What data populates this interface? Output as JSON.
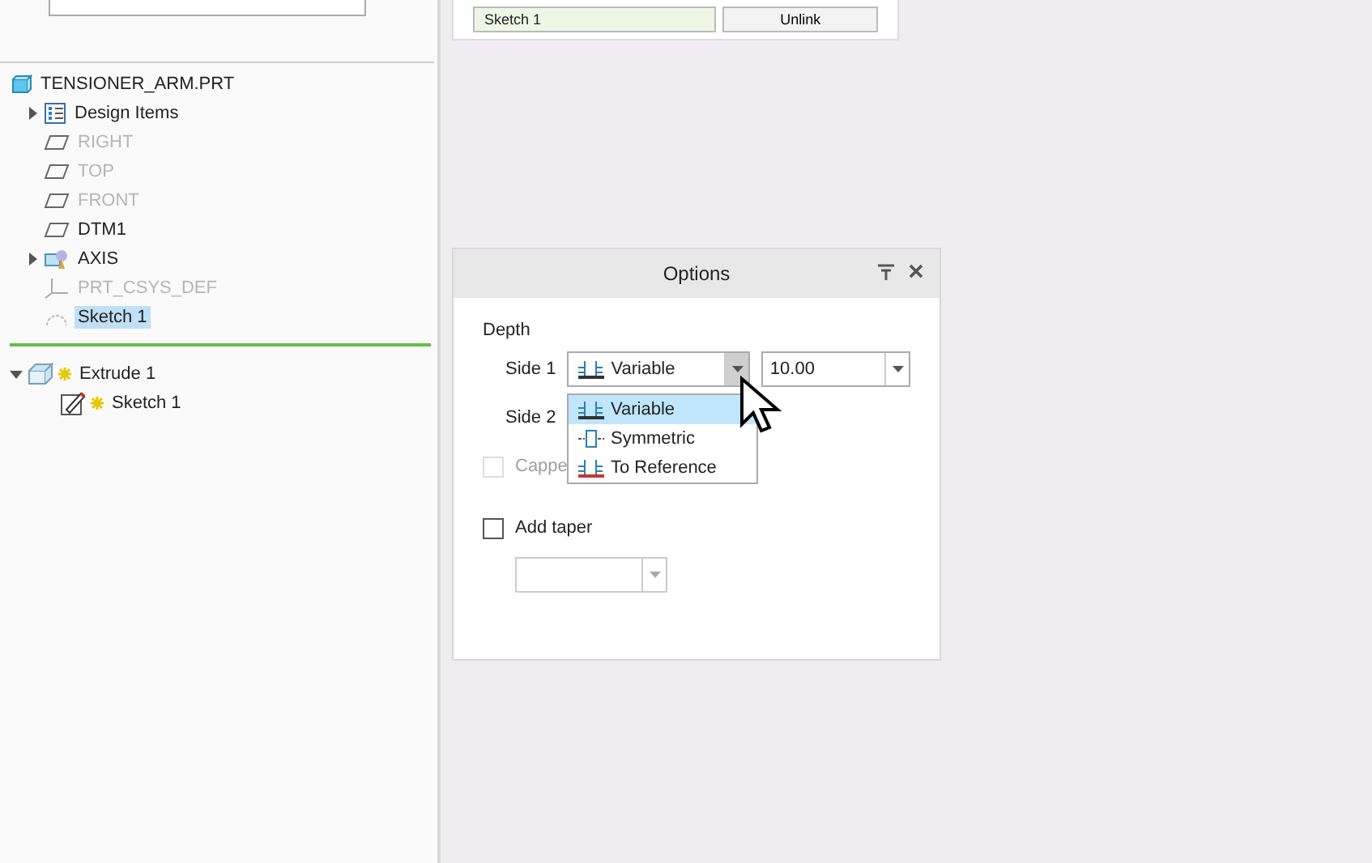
{
  "top_panel": {
    "field_value": "Sketch 1",
    "button": "Unlink"
  },
  "model_tree": {
    "root": {
      "label": "TENSIONER_ARM.PRT",
      "kind": "part"
    },
    "items": [
      {
        "kind": "layers",
        "label": "Design Items",
        "expanded": false,
        "disabled": false,
        "selected": false
      },
      {
        "kind": "plane",
        "label": "RIGHT",
        "disabled": true,
        "selected": false
      },
      {
        "kind": "plane",
        "label": "TOP",
        "disabled": true,
        "selected": false
      },
      {
        "kind": "plane",
        "label": "FRONT",
        "disabled": true,
        "selected": false
      },
      {
        "kind": "plane",
        "label": "DTM1",
        "disabled": false,
        "selected": false
      },
      {
        "kind": "axis",
        "label": "AXIS",
        "expanded": false,
        "disabled": false,
        "selected": false
      },
      {
        "kind": "csys",
        "label": "PRT_CSYS_DEF",
        "disabled": true,
        "selected": false
      },
      {
        "kind": "sketch",
        "label": "Sketch 1",
        "disabled": false,
        "selected": true
      },
      {
        "kind": "insert_marker"
      },
      {
        "kind": "extrude",
        "label": "Extrude 1",
        "expanded": true,
        "disabled": false,
        "selected": false,
        "new": true,
        "children": [
          {
            "kind": "sketch_edit",
            "label": "Sketch 1",
            "disabled": false,
            "selected": false,
            "new": true
          }
        ]
      }
    ]
  },
  "options_dialog": {
    "title": "Options",
    "section": "Depth",
    "side1": {
      "label": "Side 1",
      "value": "Variable",
      "open": true,
      "depth": "10.00",
      "options": [
        {
          "label": "Variable",
          "kind": "variable",
          "selected": true
        },
        {
          "label": "Symmetric",
          "kind": "symmetric",
          "selected": false
        },
        {
          "label": "To Reference",
          "kind": "reference",
          "selected": false
        }
      ]
    },
    "side2": {
      "label": "Side 2"
    },
    "capped": {
      "label": "Cappe",
      "checked": false,
      "disabled": true
    },
    "taper": {
      "label": "Add taper",
      "checked": false,
      "disabled": false
    }
  }
}
